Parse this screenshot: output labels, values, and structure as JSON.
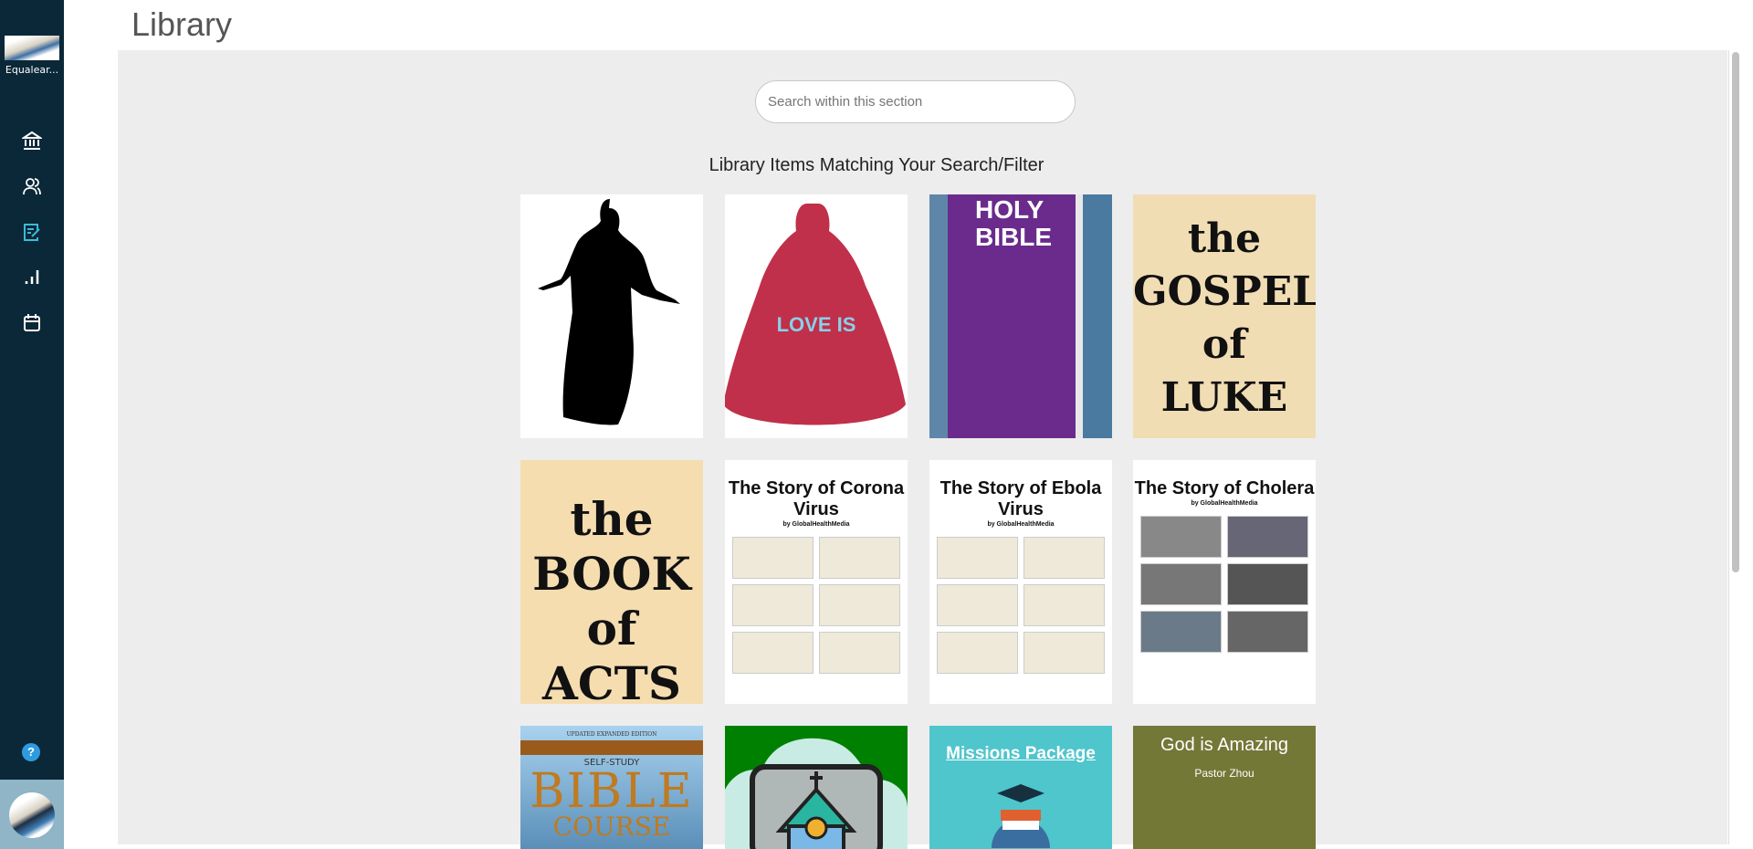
{
  "sidebar": {
    "brand": "Equalear...",
    "nav": [
      {
        "icon": "institution-icon"
      },
      {
        "icon": "users-icon"
      },
      {
        "icon": "assignment-icon",
        "active": true
      },
      {
        "icon": "stats-icon"
      },
      {
        "icon": "calendar-icon"
      }
    ],
    "help": "?",
    "accent": "#3cb9d9"
  },
  "page": {
    "title": "Library"
  },
  "search": {
    "placeholder": "Search within this section"
  },
  "heading": "Library Items Matching Your Search/Filter",
  "items": [
    {
      "label": "Jesus silhouette"
    },
    {
      "text": "LOVE IS"
    },
    {
      "text": "HOLY BIBLE"
    },
    {
      "text": "the GOSPEL of LUKE"
    },
    {
      "text": "the BOOK of ACTS"
    },
    {
      "title": "The Story of Corona Virus",
      "by": "by GlobalHealthMedia"
    },
    {
      "title": "The Story of Ebola Virus",
      "by": "by GlobalHealthMedia"
    },
    {
      "title": "The Story of Cholera",
      "by": "by GlobalHealthMedia"
    },
    {
      "edition": "UPDATED EXPANDED EDITION",
      "sub": "SELF-STUDY",
      "text": "BIBLE",
      "text2": "COURSE"
    },
    {
      "label": "Church broadcast"
    },
    {
      "title": "Missions Package"
    },
    {
      "title": "God is Amazing",
      "author": "Pastor Zhou"
    }
  ]
}
